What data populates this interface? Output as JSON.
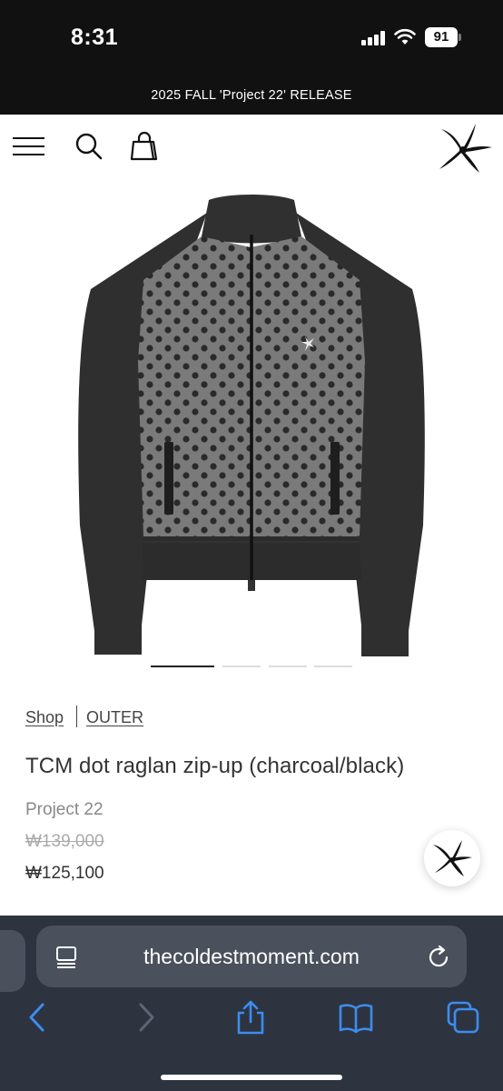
{
  "status_bar": {
    "time": "8:31",
    "battery": "91"
  },
  "announcement": "2025 FALL 'Project 22' RELEASE",
  "header": {
    "icons": [
      "menu-icon",
      "search-icon",
      "shopping-bag-icon",
      "starfish-logo"
    ]
  },
  "gallery": {
    "slide_count": 4,
    "active_index": 0
  },
  "breadcrumb": {
    "shop": "Shop",
    "category": "OUTER"
  },
  "product": {
    "title": "TCM dot raglan zip-up (charcoal/black)",
    "brand": "Project 22",
    "original_price": "₩139,000",
    "sale_price": "₩125,100"
  },
  "browser": {
    "url": "thecoldestmoment.com",
    "toolbar_icons": [
      "back-icon",
      "forward-icon",
      "share-icon",
      "bookmarks-icon",
      "tabs-icon"
    ]
  },
  "colors": {
    "dark": "#111111",
    "toolbar": "#2d3440",
    "accent_blue": "#3d8cf0"
  }
}
